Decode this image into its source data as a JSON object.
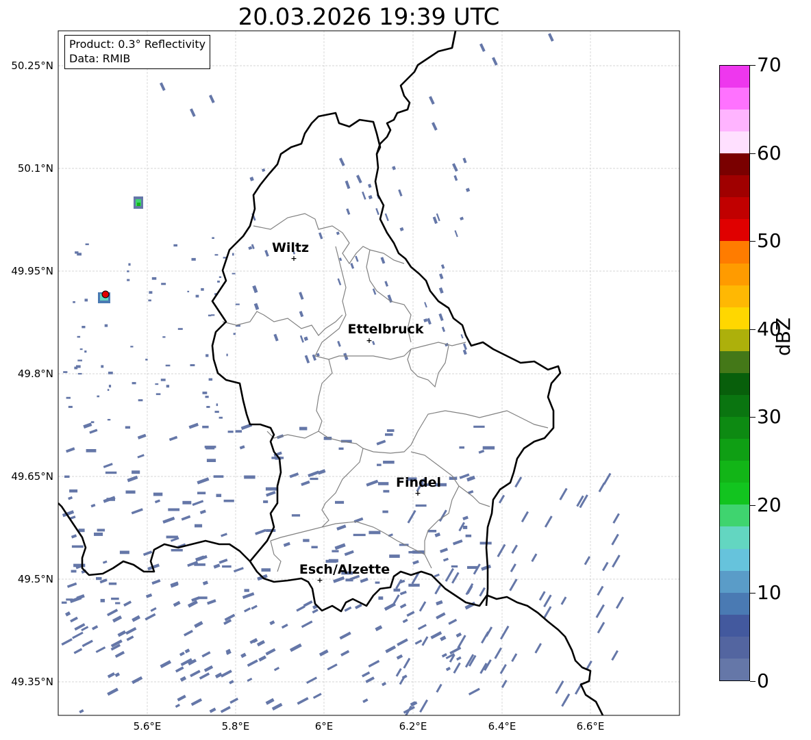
{
  "title": "20.03.2026 19:39 UTC",
  "info": {
    "product": "Product: 0.3° Reflectivity",
    "data": "Data: RMIB"
  },
  "latitude_labels": [
    "50.25°N",
    "50.1°N",
    "49.95°N",
    "49.8°N",
    "49.65°N",
    "49.5°N",
    "49.35°N"
  ],
  "longitude_labels": [
    "5.6°E",
    "5.8°E",
    "6°E",
    "6.2°E",
    "6.4°E",
    "6.6°E"
  ],
  "cities": [
    {
      "name": "Wiltz"
    },
    {
      "name": "Ettelbruck"
    },
    {
      "name": "Findel"
    },
    {
      "name": "Esch/Alzette"
    }
  ],
  "colorbar": {
    "label": "dBZ",
    "ticks": [
      "0",
      "10",
      "20",
      "30",
      "40",
      "50",
      "60",
      "70"
    ],
    "colors": [
      "#6577a8",
      "#5365a0",
      "#43599e",
      "#4a7ab3",
      "#5a9cc8",
      "#66c3dc",
      "#63d6c1",
      "#3fd46f",
      "#12c41f",
      "#12b517",
      "#0f9f14",
      "#0d8a12",
      "#0a7510",
      "#085f0b",
      "#447818",
      "#adb00b",
      "#ffd700",
      "#ffb803",
      "#ff9b00",
      "#ff7c00",
      "#e00000",
      "#c10000",
      "#a00000",
      "#7a0000",
      "#ffe0ff",
      "#ffb4ff",
      "#ff72ff",
      "#ee37ee"
    ]
  },
  "map_colors": {
    "radar_echo": "#6577a8",
    "border": "#000000",
    "canton": "#808080",
    "grid": "#c8c8c8"
  }
}
